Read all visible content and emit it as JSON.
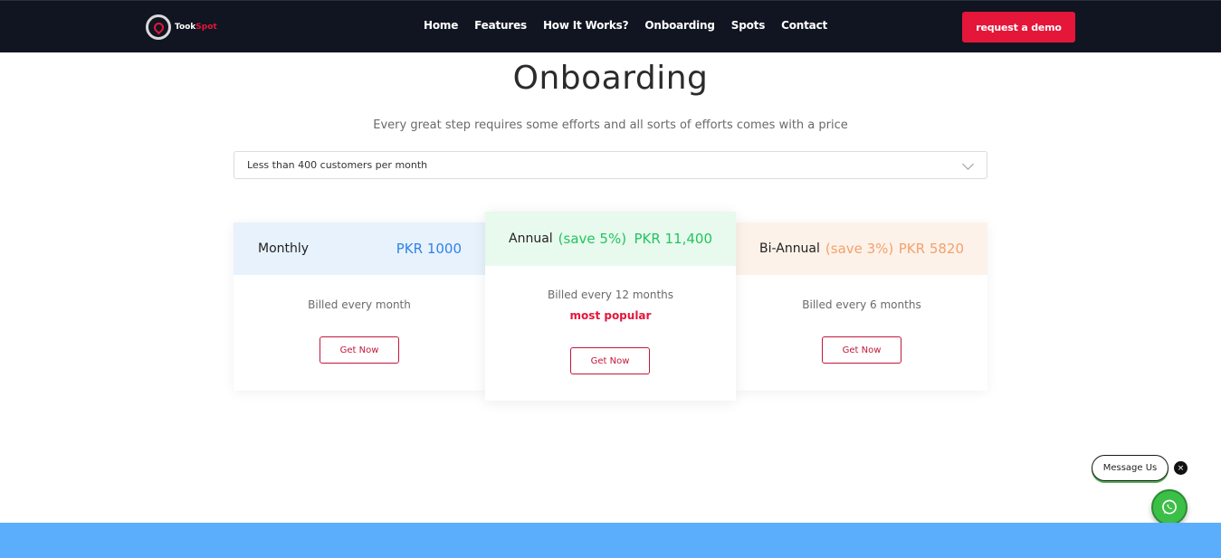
{
  "brand": {
    "name_a": "Took",
    "name_b": "Spot",
    "accent": "#e4163a",
    "nav_bg": "#101521"
  },
  "nav": {
    "items": [
      {
        "label": "Home"
      },
      {
        "label": "Features"
      },
      {
        "label": "How It Works?"
      },
      {
        "label": "Onboarding"
      },
      {
        "label": "Spots"
      },
      {
        "label": "Contact"
      }
    ],
    "cta": "request a demo"
  },
  "hero": {
    "title": "Onboarding",
    "subtitle": "Every great step requires some efforts and all sorts of efforts comes with a price"
  },
  "select": {
    "value": "Less than 400 customers per month",
    "icon": "chevron-down-icon"
  },
  "plans": [
    {
      "name": "Monthly",
      "save": "",
      "price": "PKR 1000",
      "billed": "Billed every month",
      "badge": "",
      "button": "Get Now",
      "head_bg": "#e8f2fd",
      "color": "#2f83e6"
    },
    {
      "name": "Annual",
      "save": "(save 5%)",
      "price": "PKR 11,400",
      "billed": "Billed every 12 months",
      "badge": "most popular",
      "button": "Get Now",
      "head_bg": "#e8f9ee",
      "color": "#22c55e"
    },
    {
      "name": "Bi-Annual",
      "save": "(save 3%)",
      "price": "PKR 5820",
      "billed": "Billed every 6 months",
      "badge": "",
      "button": "Get Now",
      "head_bg": "#fdf2ea",
      "color": "#f2a26b"
    }
  ],
  "widgets": {
    "message_label": "Message Us",
    "close_glyph": "×",
    "whatsapp_icon": "whatsapp-icon"
  },
  "footer": {
    "band_color": "#5aaefb"
  }
}
